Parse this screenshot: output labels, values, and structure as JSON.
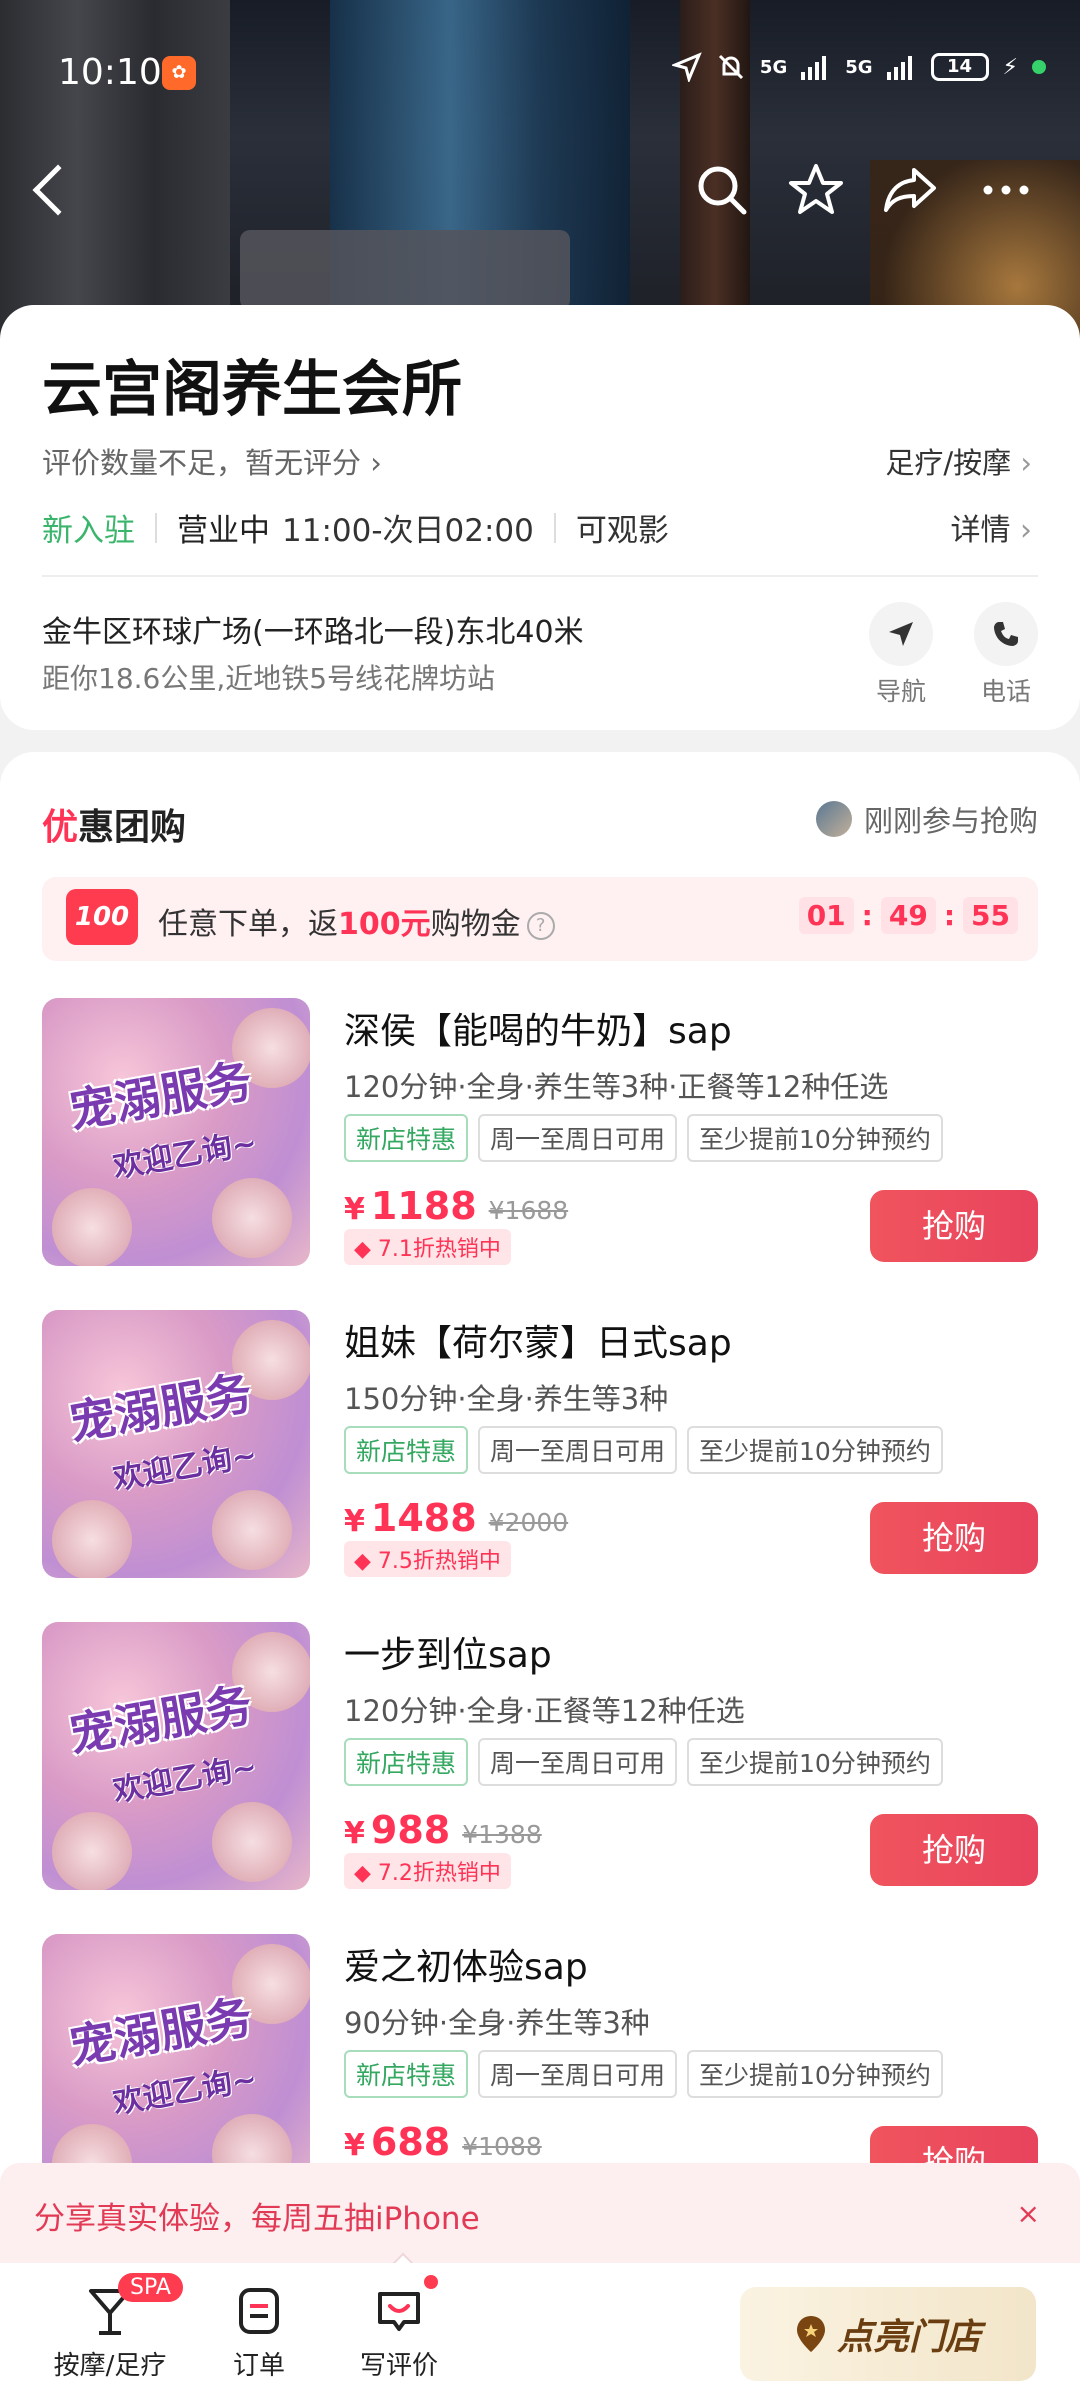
{
  "status_bar": {
    "time": "10:10",
    "battery": "14",
    "signal_a": "5G",
    "signal_b": "5G"
  },
  "shop": {
    "name": "云宫阁养生会所",
    "rating_text": "评价数量不足，暂无评分",
    "category": "足疗/按摩",
    "new_label": "新入驻",
    "open_status": "营业中",
    "hours": "11:00-次日02:00",
    "feature": "可观影",
    "detail_label": "详情",
    "address": "金牛区环球广场(一环路北一段)东北40米",
    "distance": "距你18.6公里,近地铁5号线花牌坊站",
    "nav_label": "导航",
    "phone_label": "电话"
  },
  "deals": {
    "title_first": "优",
    "title_rest": "惠团购",
    "joined_text": "刚刚参与抢购",
    "promo": {
      "badge": "100",
      "text_before": "任意下单，返",
      "text_highlight": "100元",
      "text_after": "购物金",
      "timer": [
        "01",
        "49",
        "55"
      ]
    },
    "thumb_title": "宠溺服务",
    "thumb_sub": "欢迎乙询~",
    "items": [
      {
        "name": "深侯【能喝的牛奶】sap",
        "desc": "120分钟·全身·养生等3种·正餐等12种任选",
        "tag1": "新店特惠",
        "tag2": "周一至周日可用",
        "tag3": "至少提前10分钟预约",
        "yen": "¥",
        "price": "1188",
        "old_price": "¥1688",
        "discount": "7.1折热销中",
        "buy": "抢购"
      },
      {
        "name": "姐妹【荷尔蒙】日式sap",
        "desc": "150分钟·全身·养生等3种",
        "tag1": "新店特惠",
        "tag2": "周一至周日可用",
        "tag3": "至少提前10分钟预约",
        "yen": "¥",
        "price": "1488",
        "old_price": "¥2000",
        "discount": "7.5折热销中",
        "buy": "抢购"
      },
      {
        "name": "一步到位sap",
        "desc": "120分钟·全身·正餐等12种任选",
        "tag1": "新店特惠",
        "tag2": "周一至周日可用",
        "tag3": "至少提前10分钟预约",
        "yen": "¥",
        "price": "988",
        "old_price": "¥1388",
        "discount": "7.2折热销中",
        "buy": "抢购"
      },
      {
        "name": "爱之初体验sap",
        "desc": "90分钟·全身·养生等3种",
        "tag1": "新店特惠",
        "tag2": "周一至周日可用",
        "tag3": "至少提前10分钟预约",
        "yen": "¥",
        "price": "688",
        "old_price": "¥1088",
        "discount": "",
        "buy": "抢购"
      }
    ]
  },
  "notice": {
    "text": "分享真实体验，每周五抽iPhone",
    "close": "×"
  },
  "bottom_bar": {
    "tab1": "按摩/足疗",
    "tab1_badge": "SPA",
    "tab2": "订单",
    "tab3": "写评价",
    "cta": "点亮门店"
  },
  "colors": {
    "accent": "#ff3355",
    "green": "#34a861",
    "buy": "#ec4a5d"
  }
}
